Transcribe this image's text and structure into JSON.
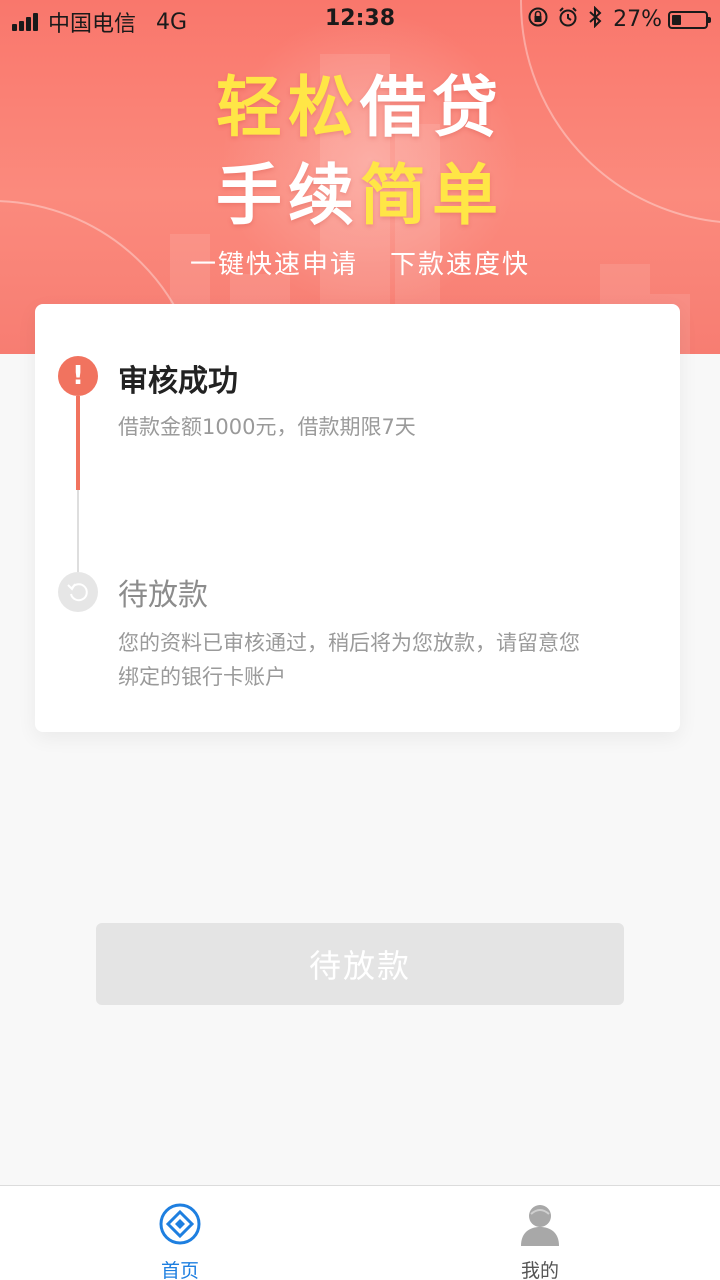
{
  "status_bar": {
    "carrier": "中国电信",
    "network": "4G",
    "time": "12:38",
    "battery_percent": "27%",
    "battery_level": 0.27,
    "icons": [
      "signal-icon",
      "orientation-lock-icon",
      "alarm-icon",
      "bluetooth-icon",
      "battery-icon"
    ]
  },
  "banner": {
    "line1_highlight": "轻松",
    "line1_rest": "借贷",
    "line2_start": "手续",
    "line2_highlight": "简单",
    "sub_left": "一键快速申请",
    "sub_right": "下款速度快",
    "highlight_color": "#ffe646",
    "background_color": "#f9776c"
  },
  "progress": {
    "steps": [
      {
        "title": "审核成功",
        "desc": "借款金额1000元，借款期限7天",
        "icon": "exclamation-icon",
        "state": "done"
      },
      {
        "title": "待放款",
        "desc": "您的资料已审核通过，稍后将为您放款，请留意您绑定的银行卡账户",
        "icon": "refresh-icon",
        "state": "pending"
      }
    ],
    "active_color": "#f1735f"
  },
  "action_button": {
    "label": "待放款"
  },
  "tabbar": {
    "items": [
      {
        "label": "首页",
        "icon": "home-diamond-icon",
        "active": true
      },
      {
        "label": "我的",
        "icon": "user-icon",
        "active": false
      }
    ],
    "active_color": "#1e7fe0"
  }
}
